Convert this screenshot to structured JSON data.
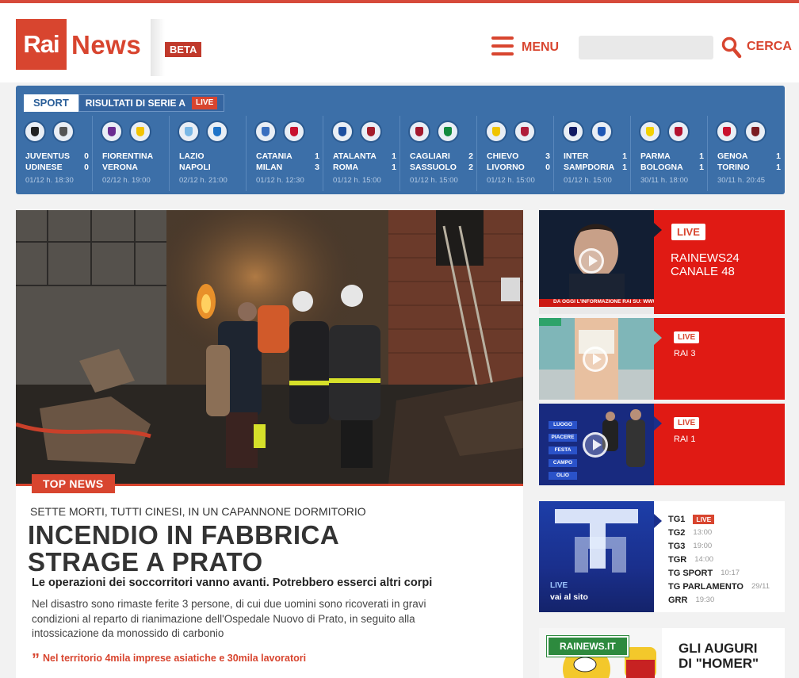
{
  "header": {
    "logo_rai": "Rai",
    "logo_news": "News",
    "beta": "BETA",
    "menu_label": "MENU",
    "search_placeholder": "",
    "search_label": "CERCA"
  },
  "scores": {
    "sport_tab": "SPORT",
    "title": "RISULTATI DI SERIE A",
    "live": "LIVE",
    "matches": [
      {
        "home": "JUVENTUS",
        "home_score": "0",
        "away": "UDINESE",
        "away_score": "0",
        "time": "01/12  h. 18:30",
        "home_color": "#222222",
        "away_color": "#555555"
      },
      {
        "home": "FIORENTINA",
        "home_score": "",
        "away": "VERONA",
        "away_score": "",
        "time": "02/12  h. 19:00",
        "home_color": "#6a2c91",
        "away_color": "#f2c300"
      },
      {
        "home": "LAZIO",
        "home_score": "",
        "away": "NAPOLI",
        "away_score": "",
        "time": "02/12  h. 21:00",
        "home_color": "#7ab8e6",
        "away_color": "#1e73c8"
      },
      {
        "home": "CATANIA",
        "home_score": "1",
        "away": "MILAN",
        "away_score": "3",
        "time": "01/12  h. 12:30",
        "home_color": "#3a6fbf",
        "away_color": "#c8102e"
      },
      {
        "home": "ATALANTA",
        "home_score": "1",
        "away": "ROMA",
        "away_score": "1",
        "time": "01/12  h. 15:00",
        "home_color": "#1c4fa0",
        "away_color": "#a31d2b"
      },
      {
        "home": "CAGLIARI",
        "home_score": "2",
        "away": "SASSUOLO",
        "away_score": "2",
        "time": "01/12  h. 15:00",
        "home_color": "#a3192e",
        "away_color": "#138a3e"
      },
      {
        "home": "CHIEVO",
        "home_score": "3",
        "away": "LIVORNO",
        "away_score": "0",
        "time": "01/12  h. 15:00",
        "home_color": "#f0c400",
        "away_color": "#b01c3a"
      },
      {
        "home": "INTER",
        "home_score": "1",
        "away": "SAMPDORIA",
        "away_score": "1",
        "time": "01/12  h. 15:00",
        "home_color": "#111a63",
        "away_color": "#1e57b5"
      },
      {
        "home": "PARMA",
        "home_score": "1",
        "away": "BOLOGNA",
        "away_score": "1",
        "time": "30/11  h. 18:00",
        "home_color": "#f2d100",
        "away_color": "#b3122f"
      },
      {
        "home": "GENOA",
        "home_score": "1",
        "away": "TORINO",
        "away_score": "1",
        "time": "30/11  h. 20:45",
        "home_color": "#c8102e",
        "away_color": "#7a1c22"
      }
    ]
  },
  "main": {
    "top_news_label": "TOP NEWS",
    "kicker": "SETTE MORTI, TUTTI CINESI, IN UN CAPANNONE DORMITORIO",
    "headline_line1": "INCENDIO IN FABBRICA",
    "headline_line2": "STRAGE A PRATO",
    "subtitle": "Le operazioni dei soccorritori vanno avanti. Potrebbero esserci altri corpi",
    "body": "Nel disastro sono rimaste ferite 3 persone, di cui due uomini sono ricoverati in gravi condizioni al reparto di rianimazione dell'Ospedale Nuovo di Prato, in seguito alla intossicazione da monossido di carbonio",
    "related_link": "Nel territorio 4mila imprese asiatiche e 30mila lavoratori"
  },
  "live_channels": [
    {
      "tag": "LIVE",
      "name_line1": "RAINEWS24",
      "name_line2": "CANALE 48",
      "ticker": "DA OGGI L'INFORMAZIONE RAI SU: WWW.RAINEW"
    },
    {
      "tag": "LIVE",
      "name_line1": "RAI 3",
      "name_line2": ""
    },
    {
      "tag": "LIVE",
      "name_line1": "RAI 1",
      "name_line2": ""
    }
  ],
  "tg": {
    "live_label": "LIVE",
    "site_link": "vai al sito",
    "rows": [
      {
        "name": "TG1",
        "time": "",
        "live": "LIVE"
      },
      {
        "name": "TG2",
        "time": "13:00",
        "live": ""
      },
      {
        "name": "TG3",
        "time": "19:00",
        "live": ""
      },
      {
        "name": "TGR",
        "time": "14:00",
        "live": ""
      },
      {
        "name": "TG SPORT",
        "time": "10:17",
        "live": ""
      },
      {
        "name": "TG PARLAMENTO",
        "time": "29/11",
        "live": ""
      },
      {
        "name": "GRR",
        "time": "19:30",
        "live": ""
      }
    ]
  },
  "rai3_menu": [
    "LUOGO",
    "PIACERE",
    "FESTA",
    "CAMPO",
    "OLIO"
  ],
  "promo": {
    "badge": "RAINEWS.IT",
    "title_line1": "GLI AUGURI",
    "title_line2": "DI \"HOMER\""
  }
}
